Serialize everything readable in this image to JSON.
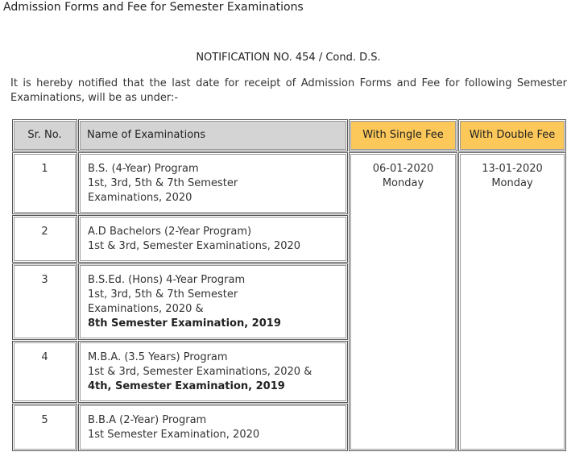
{
  "page": {
    "title": "Admission Forms and Fee for Semester Examinations",
    "notification": "NOTIFICATION NO. 454 / Cond. D.S.",
    "intro": "It is hereby notified that the last date for receipt of Admission Forms and Fee for following Semester Examinations, will be as under:-"
  },
  "table": {
    "headers": {
      "sr": "Sr. No.",
      "name": "Name of Examinations",
      "single": "With Single Fee",
      "double": "With Double Fee"
    },
    "rows": [
      {
        "sr": "1",
        "lines": [
          "B.S. (4-Year) Program",
          "1st, 3rd, 5th & 7th Semester",
          "Examinations, 2020"
        ],
        "bold": ""
      },
      {
        "sr": "2",
        "lines": [
          "A.D Bachelors (2-Year Program)",
          "1st & 3rd, Semester Examinations, 2020"
        ],
        "bold": ""
      },
      {
        "sr": "3",
        "lines": [
          "B.S.Ed. (Hons) 4-Year Program",
          "1st, 3rd, 5th & 7th Semester",
          "Examinations, 2020 &"
        ],
        "bold": "8th Semester Examination, 2019"
      },
      {
        "sr": "4",
        "lines": [
          "M.B.A. (3.5 Years) Program",
          "1st & 3rd, Semester Examinations, 2020 &"
        ],
        "bold": "4th, Semester Examination, 2019"
      },
      {
        "sr": "5",
        "lines": [
          "B.B.A (2-Year) Program",
          "1st Semester Examination, 2020"
        ],
        "bold": ""
      }
    ],
    "single_fee": {
      "date": "06-01-2020",
      "day": "Monday"
    },
    "double_fee": {
      "date": "13-01-2020",
      "day": "Monday"
    }
  },
  "colors": {
    "header_gray": "#d4d4d4",
    "header_gold": "#fcc85a",
    "border": "#555555"
  }
}
